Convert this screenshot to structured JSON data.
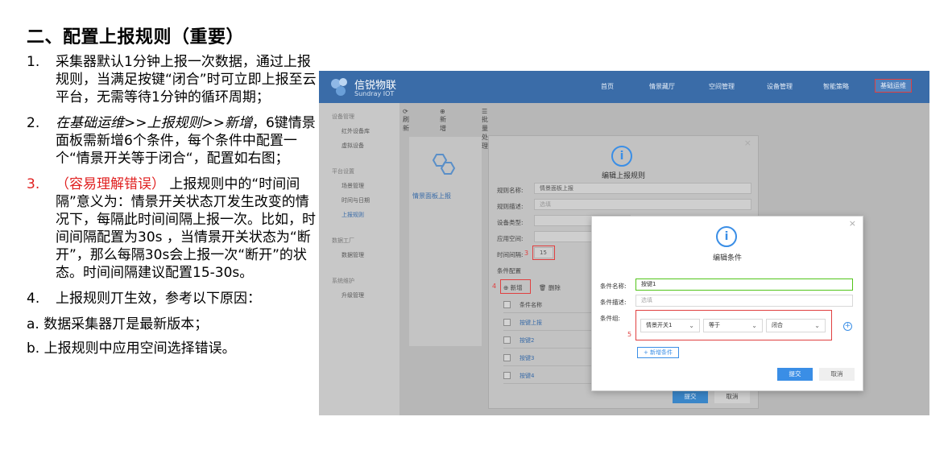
{
  "title": "二、配置上报规则（重要）",
  "steps": [
    {
      "num": "1.",
      "text": "采集器默认1分钟上报一次数据，通过上报规则，当满足按键“闭合”时可立即上报至云平台，无需等待1分钟的循环周期；"
    },
    {
      "num": "2.",
      "italic": "在基础运维>>上报规则>>新增",
      "text": "，6键情景面板需新增6个条件，每个条件中配置一个“情景开关等于闭合“，配置如右图；"
    },
    {
      "num": "3.",
      "red": "（容易理解错误）",
      "text": " 上报规则中的“时间间隔”意义为：情景开关状态丌发生改变的情况下，每隔此时间间隔上报一次。比如，时间间隔配置为30s ，当情景开关状态为“断开”，那么每隔30s会上报一次“断开”的状态。时间间隔建议配置15-30s。"
    },
    {
      "num": "4.",
      "text": "上报规则丌生效，参考以下原因："
    }
  ],
  "reasons": [
    "a. 数据采集器丌是最新版本；",
    "b. 上报规则中应用空间选择错误。"
  ],
  "screenshot": {
    "brand": "信锐物联",
    "brand_sub": "Sundray IOT",
    "nav": [
      "首页",
      "情景藏厅",
      "空间管理",
      "设备管理",
      "智能策略",
      "基础运维"
    ],
    "sidebar": {
      "groups": [
        "设备管理",
        "平台设置",
        "数据工厂",
        "系统维护"
      ],
      "items": [
        "红外设备库",
        "虚拟设备",
        "场景管理",
        "时间与日期",
        "上报规则",
        "数据管理",
        "升级管理"
      ]
    },
    "toolbar": [
      "刷新",
      "新增",
      "批量处理"
    ],
    "card_label": "情景面板上报",
    "rule_dialog": {
      "title": "编辑上报规则",
      "fields": [
        {
          "label": "规则名称:",
          "value": "情景面板上报"
        },
        {
          "label": "规则描述:",
          "value": "选填"
        },
        {
          "label": "设备类型:",
          "value": ""
        },
        {
          "label": "应用空间:",
          "value": ""
        },
        {
          "label": "时间间隔:",
          "value": "15"
        }
      ],
      "marker_3": "3",
      "section": "条件配置",
      "marker_4": "4",
      "add": "新增",
      "delete": "删除",
      "col_header": "条件名称",
      "rows": [
        "按键上报",
        "按键2",
        "按键3",
        "按键4"
      ],
      "ok": "提交",
      "cancel": "取消"
    },
    "cond_dialog": {
      "title": "编辑条件",
      "name_label": "条件名称:",
      "name_value": "按键1",
      "desc_label": "条件描述:",
      "desc_placeholder": "选填",
      "group_label": "条件组:",
      "marker_5": "5",
      "sel_device": "情景开关1",
      "sel_op": "等于",
      "sel_value": "闭合",
      "add_cond": "+ 新增条件",
      "ok": "提交",
      "cancel": "取消"
    }
  },
  "colors": {
    "brand_blue": "#3a6ca8",
    "accent_red": "#e02020",
    "primary": "#3a8ee6"
  }
}
